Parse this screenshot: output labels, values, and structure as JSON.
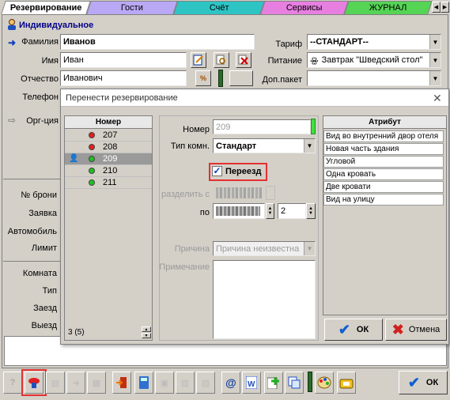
{
  "tabs": {
    "booking": "Резервирование",
    "guests": "Гости",
    "bill": "Счёт",
    "services": "Сервисы",
    "journal": "ЖУРНАЛ"
  },
  "guest": {
    "header": "Индивидуальное",
    "surname_label": "Фамилия",
    "surname": "Иванов",
    "name_label": "Имя",
    "name": "Иван",
    "patronymic_label": "Отчество",
    "patronymic": "Иванович",
    "phone_label": "Телефон",
    "org_label": "Орг-ция",
    "tarif_label": "Тариф",
    "tarif": "--СТАНДАРТ--",
    "food_label": "Питание",
    "food": "Завтрак \"Шведский стол\"",
    "extra_label": "Доп.пакет"
  },
  "left_labels": {
    "booking_no": "№ брони",
    "request": "Заявка",
    "car": "Автомобиль",
    "limit": "Лимит",
    "room": "Комната",
    "type": "Тип",
    "arrival": "Заезд",
    "departure": "Выезд"
  },
  "dialog": {
    "title": "Перенести резервирование",
    "rooms_header": "Номер",
    "rooms": [
      {
        "n": "207",
        "status": "red"
      },
      {
        "n": "208",
        "status": "red"
      },
      {
        "n": "209",
        "status": "green"
      },
      {
        "n": "210",
        "status": "green"
      },
      {
        "n": "211",
        "status": "green"
      }
    ],
    "selected_room": "209",
    "room_count": "3 (5)",
    "number_label": "Номер",
    "number_value": "209",
    "room_type_label": "Тип комн.",
    "room_type": "Стандарт",
    "move_checkbox": "Переезд",
    "split_label": "разделить с",
    "to_label": "по",
    "nights": "2",
    "reason_label": "Причина",
    "reason": "Причина неизвестна",
    "note_label": "Примечание",
    "attr_header": "Атрибут",
    "attributes": [
      "Вид во внутренний двор отеля",
      "Новая часть здания",
      "Угловой",
      "Одна кровать",
      "Две кровати",
      "Вид на улицу"
    ],
    "ok": "ОК",
    "cancel": "Отмена"
  },
  "main_ok": "ОК",
  "colors": {
    "tab_booking": "#ffffff",
    "tab_guests": "#b9a9f5",
    "tab_bill": "#2ec4c4",
    "tab_services": "#e77fe0",
    "tab_journal": "#55d455",
    "highlight": "#e53030",
    "selected_row": "#9a9a9a"
  }
}
